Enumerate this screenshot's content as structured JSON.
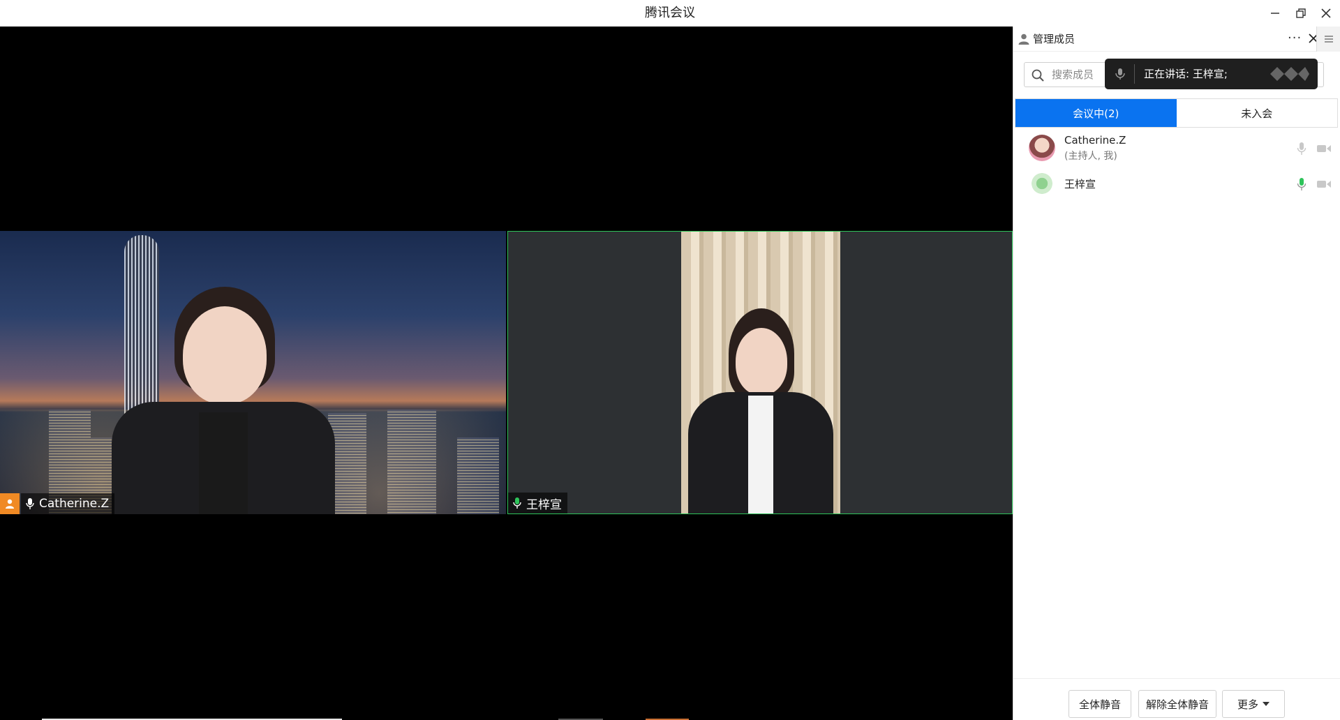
{
  "window": {
    "title": "腾讯会议"
  },
  "participants_panel": {
    "title": "管理成员",
    "more_label": "···",
    "search": {
      "placeholder": "搜索成员"
    },
    "speaking_toast": "正在讲话: 王梓宣;",
    "tabs": [
      {
        "label": "会议中(2)",
        "active": true
      },
      {
        "label": "未入会",
        "active": false
      }
    ],
    "members": [
      {
        "name": "Catherine.Z",
        "role": "(主持人, 我)",
        "mic": "muted-gray",
        "camera": "off-gray"
      },
      {
        "name": "王梓宣",
        "role": "",
        "mic": "active-green",
        "camera": "off-gray"
      }
    ],
    "footer_buttons": {
      "mute_all": "全体静音",
      "unmute_all": "解除全体静音",
      "more": "更多"
    }
  },
  "video_tiles": [
    {
      "name": "Catherine.Z",
      "badge_icon": "user-icon",
      "mic_state": "white",
      "active_speaker": false
    },
    {
      "name": "王梓宣",
      "mic_state": "green",
      "active_speaker": true
    }
  ],
  "colors": {
    "accent": "#0a73f0",
    "speaking_border": "#2ec35a",
    "mic_active": "#2ec35a",
    "host_badge": "#f08a24"
  }
}
